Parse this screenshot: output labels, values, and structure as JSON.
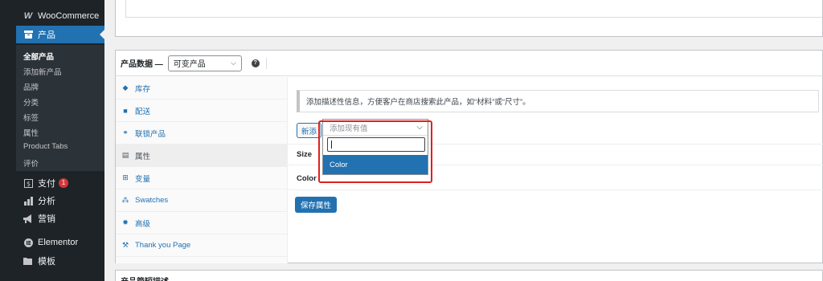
{
  "sidebar": {
    "woocommerce": {
      "label": "WooCommerce",
      "icon": "woocommerce-icon"
    },
    "products": {
      "label": "产品",
      "icon": "archive-icon"
    },
    "submenu": [
      "全部产品",
      "添加新产品",
      "品牌",
      "分类",
      "标签",
      "属性",
      "Product Tabs",
      "评价"
    ],
    "payments": {
      "label": "支付",
      "icon": "dollar-icon",
      "badge": "1"
    },
    "analytics": {
      "label": "分析",
      "icon": "bar-chart-icon"
    },
    "marketing": {
      "label": "营销",
      "icon": "megaphone-icon"
    },
    "elementor": {
      "label": "Elementor",
      "icon": "elementor-icon"
    },
    "templates": {
      "label": "模板",
      "icon": "folder-icon"
    }
  },
  "product_data": {
    "title": "产品数据 —",
    "type_value": "可变产品",
    "tabs": [
      "库存",
      "配送",
      "联锁产品",
      "属性",
      "变量",
      "Swatches",
      "高级",
      "Thank you Page"
    ],
    "notice": "添加描述性信息，方便客户在商店搜索此产品，如“材料”或“尺寸”。",
    "add_new_label": "新添",
    "attributes": [
      "Size",
      "Color"
    ],
    "save_label": "保存属性",
    "dropdown": {
      "placeholder": "添加现有值",
      "search_value": "",
      "option": "Color"
    }
  },
  "bottom_panel": {
    "title": "产品简短描述"
  },
  "colors": {
    "accent": "#2271b1",
    "sidebar": "#1d2327",
    "highlight": "#e02020"
  }
}
